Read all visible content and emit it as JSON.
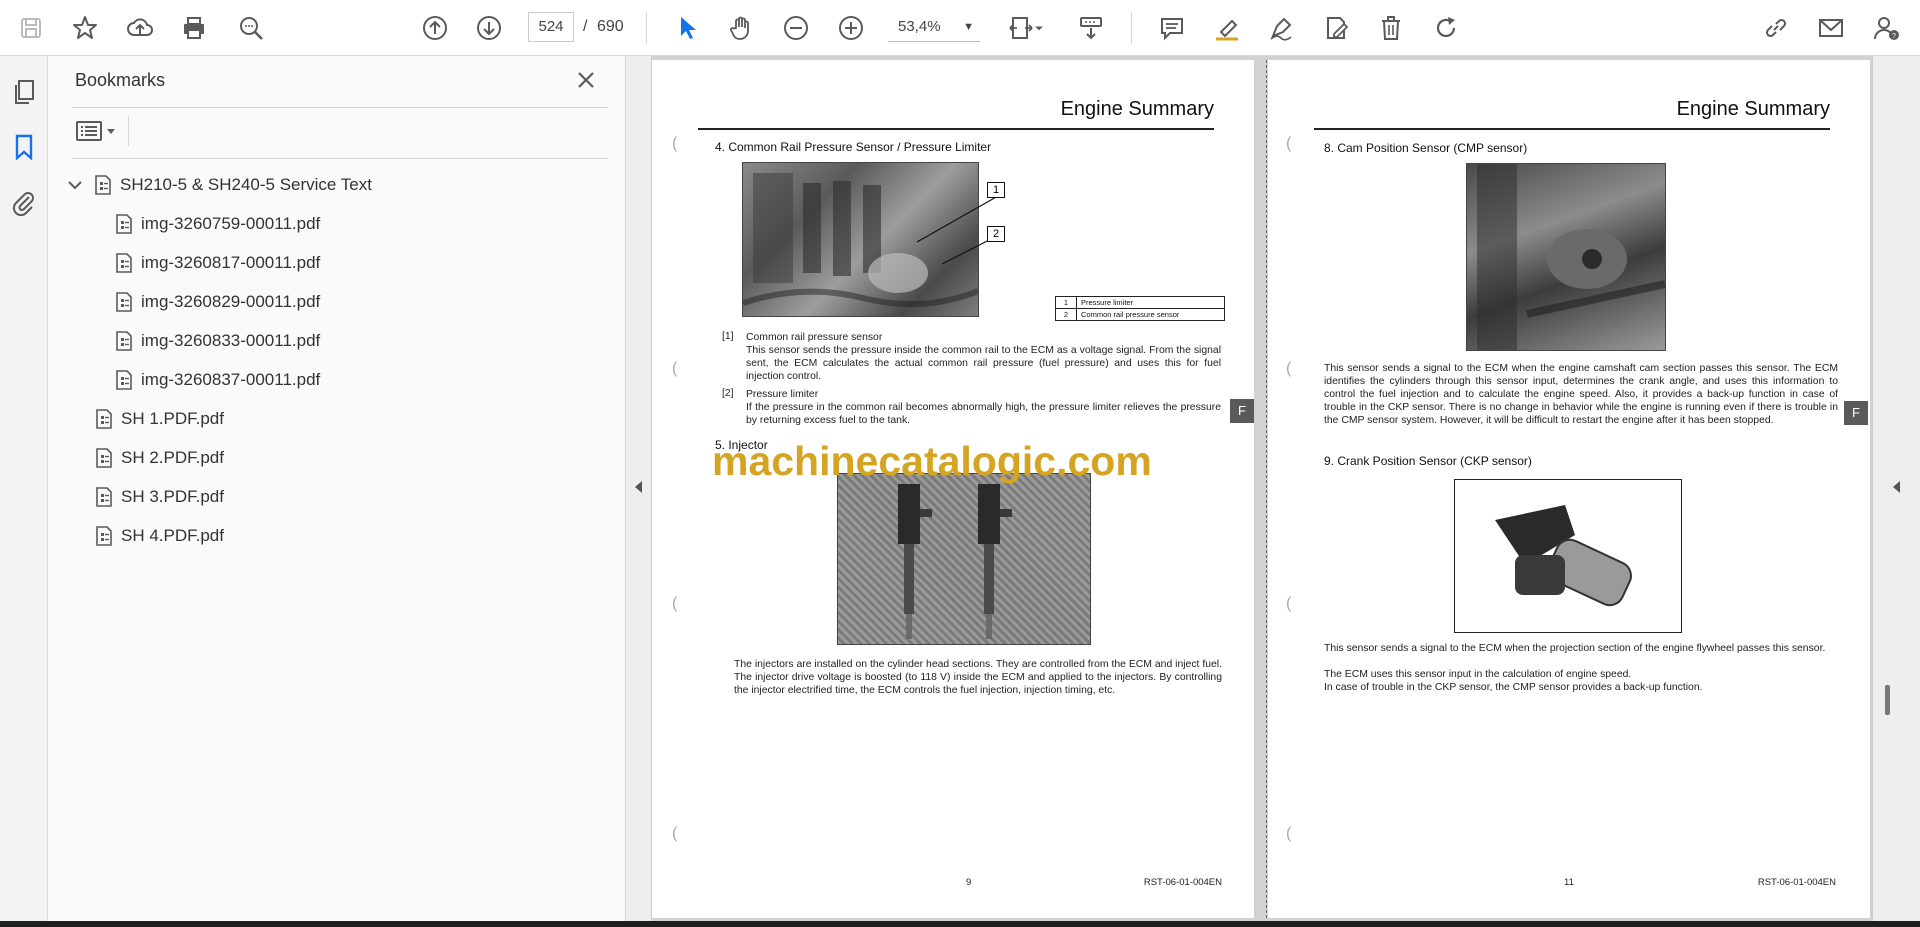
{
  "toolbar": {
    "current_page": "524",
    "page_separator": "/",
    "total_pages": "690",
    "zoom": "53,4%"
  },
  "bookmarks_panel": {
    "title": "Bookmarks",
    "items": [
      {
        "label": "SH210-5 & SH240-5 Service Text"
      },
      {
        "label": "img-3260759-00011.pdf"
      },
      {
        "label": "img-3260817-00011.pdf"
      },
      {
        "label": "img-3260829-00011.pdf"
      },
      {
        "label": "img-3260833-00011.pdf"
      },
      {
        "label": "img-3260837-00011.pdf"
      },
      {
        "label": "SH 1.PDF.pdf"
      },
      {
        "label": "SH 2.PDF.pdf"
      },
      {
        "label": "SH 3.PDF.pdf"
      },
      {
        "label": "SH 4.PDF.pdf"
      }
    ]
  },
  "left_page": {
    "header": "Engine Summary",
    "section4_title": "4. Common Rail Pressure Sensor / Pressure Limiter",
    "callout_1": "1",
    "callout_2": "2",
    "legend": [
      {
        "num": "1",
        "text": "Pressure limiter"
      },
      {
        "num": "2",
        "text": "Common rail pressure sensor"
      }
    ],
    "item1_marker": "[1]",
    "item1_title": "Common rail pressure sensor",
    "item1_text": "This sensor sends the pressure inside the common rail to the ECM as a voltage signal. From the signal sent, the ECM calculates the actual common rail pressure (fuel pressure) and uses this for fuel injection control.",
    "item2_marker": "[2]",
    "item2_title": "Pressure limiter",
    "item2_text": "If the pressure in the common rail becomes abnormally high, the pressure limiter relieves the pressure by returning excess fuel to the tank.",
    "section5_title": "5. Injector",
    "injector_text": "The injectors are installed on the cylinder head sections. They are controlled from the ECM and inject fuel. The injector drive voltage is boosted (to 118 V) inside the ECM and applied to the injectors. By controlling the injector electrified time, the ECM controls the fuel injection, injection timing, etc.",
    "tab_letter": "F",
    "page_number": "9",
    "doc_code": "RST-06-01-004EN"
  },
  "right_page": {
    "header": "Engine Summary",
    "section8_title": "8. Cam Position Sensor (CMP sensor)",
    "cmp_text": "This sensor sends a signal to the ECM when the engine camshaft cam section passes this sensor. The ECM identifies the cylinders through this sensor input, determines the crank angle, and uses this information to control the fuel injection and to calculate the engine speed. Also, it provides a back-up function in case of trouble in the CKP sensor. There is no change in behavior while the engine is running even if there is trouble in the CMP sensor system. However, it will be difficult to restart the engine after it has been stopped.",
    "section9_title": "9. Crank Position Sensor (CKP sensor)",
    "ckp_text_1": "This sensor sends a signal to the ECM when the projection section of the engine flywheel passes this sensor.",
    "ckp_text_2": "The ECM uses this sensor input in the calculation of engine speed.",
    "ckp_text_3": "In case of trouble in the CKP sensor, the CMP sensor provides a back-up function.",
    "tab_letter": "F",
    "page_number": "11",
    "doc_code": "RST-06-01-004EN"
  },
  "watermark": "machinecatalogic.com",
  "colors": {
    "accent": "#1473e6",
    "watermark": "#d4a422",
    "icon": "#5a5a5a"
  }
}
